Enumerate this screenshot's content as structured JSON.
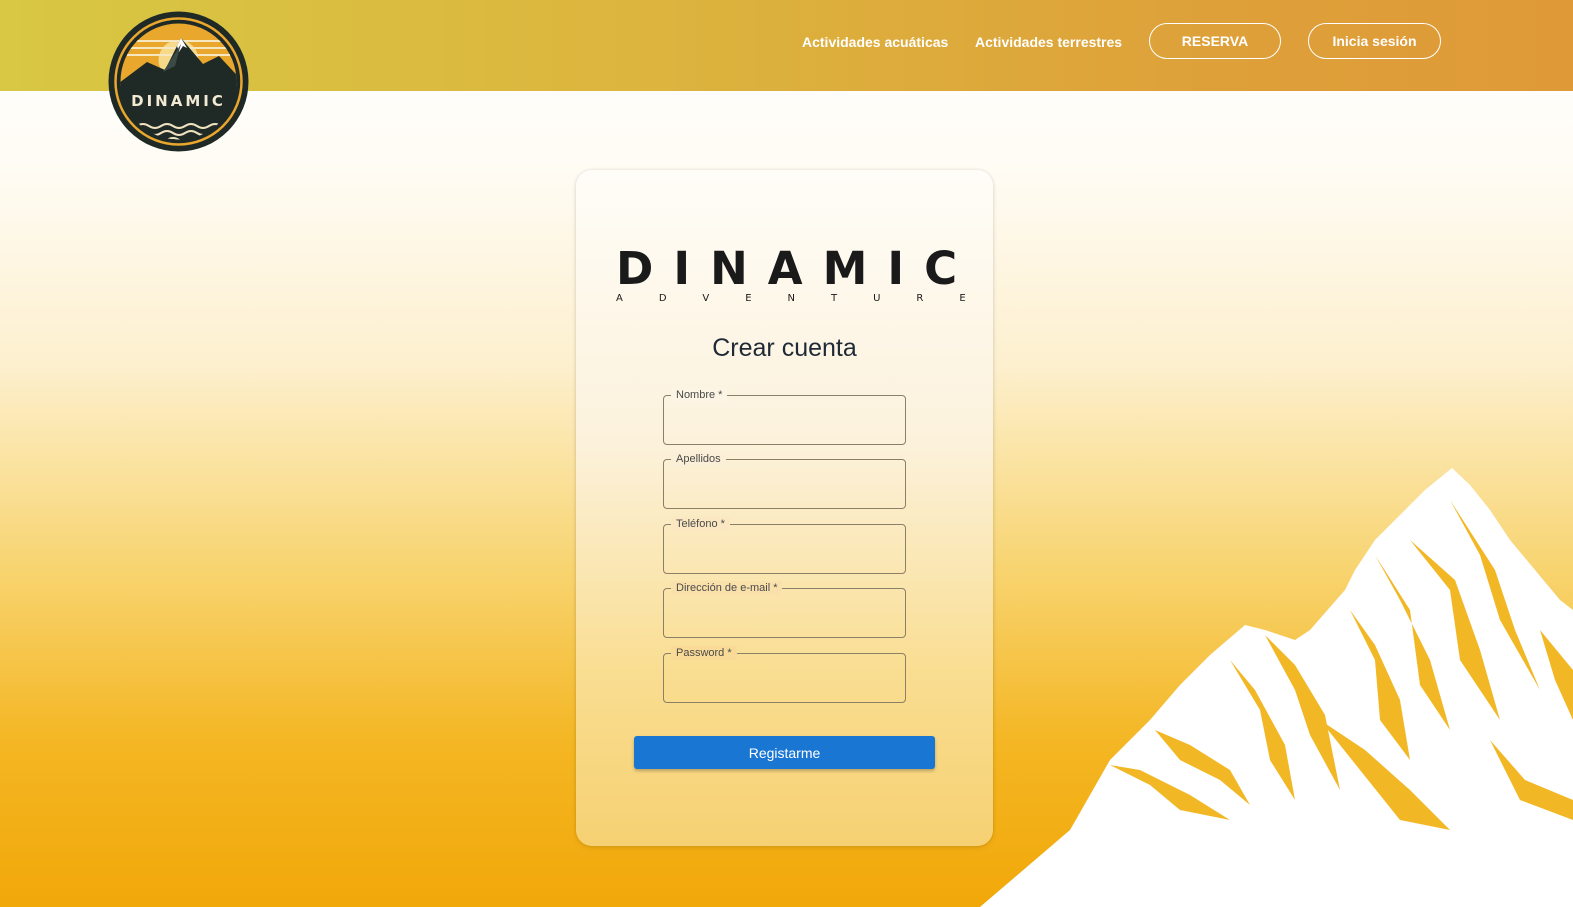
{
  "header": {
    "logo_text": "DINAMIC",
    "nav": {
      "aquatic": "Actividades acuáticas",
      "land": "Actividades terrestres",
      "reserve": "RESERVA",
      "login": "Inicia sesión"
    }
  },
  "card": {
    "brand_main": "DINAMIC",
    "brand_sub": "ADVENTURE",
    "title": "Crear cuenta",
    "fields": {
      "nombre": {
        "label": "Nombre *",
        "value": ""
      },
      "apellidos": {
        "label": "Apellidos",
        "value": ""
      },
      "telefono": {
        "label": "Teléfono *",
        "value": ""
      },
      "email": {
        "label": "Dirección de e-mail *",
        "value": ""
      },
      "password": {
        "label": "Password *",
        "value": ""
      }
    },
    "submit_label": "Registarme"
  },
  "colors": {
    "accent": "#1976d2",
    "header_start": "#d8c843",
    "header_end": "#df9a37",
    "mountain_gold": "#f2b724",
    "logo_dark": "#1f2a26"
  }
}
